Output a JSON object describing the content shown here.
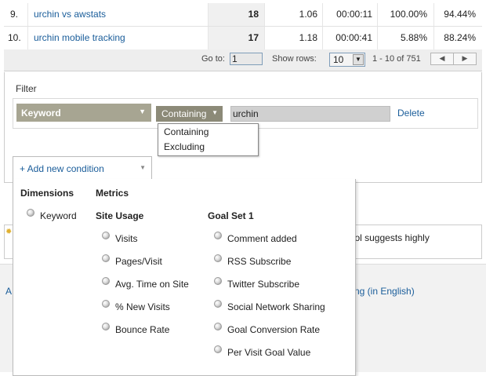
{
  "table": {
    "rows": [
      {
        "num": "9.",
        "keyword": "urchin vs awstats",
        "visits": "18",
        "pages_per_visit": "1.06",
        "avg_time": "00:00:11",
        "new_visits": "100.00%",
        "bounce_rate": "94.44%"
      },
      {
        "num": "10.",
        "keyword": "urchin mobile tracking",
        "visits": "17",
        "pages_per_visit": "1.18",
        "avg_time": "00:00:41",
        "new_visits": "5.88%",
        "bounce_rate": "88.24%"
      }
    ]
  },
  "pagination": {
    "goto_label": "Go to:",
    "goto_value": "1",
    "show_rows_label": "Show rows:",
    "show_rows_value": "10",
    "range_text": "1 - 10 of 751",
    "prev_icon": "◀",
    "next_icon": "▶"
  },
  "filter": {
    "title": "Filter",
    "dimension": "Keyword",
    "operator": "Containing",
    "value": "urchin",
    "delete_label": "Delete",
    "operator_options": [
      "Containing",
      "Excluding"
    ],
    "add_condition_label": "+ Add new condition"
  },
  "popup": {
    "dimensions_header": "Dimensions",
    "metrics_header": "Metrics",
    "dimensions": [
      "Keyword"
    ],
    "site_usage_header": "Site Usage",
    "site_usage": [
      "Visits",
      "Pages/Visit",
      "Avg. Time on Site",
      "% New Visits",
      "Bounce Rate"
    ],
    "goal_set_header": "Goal Set 1",
    "goal_set": [
      "Comment added",
      "RSS Subscribe",
      "Twitter Subscribe",
      "Social Network Sharing",
      "Goal Conversion Rate",
      "Per Visit Goal Value"
    ]
  },
  "background": {
    "notice_text": "rd Tool suggests highly",
    "footer_left": "A",
    "footer_right": "ng (in English)"
  },
  "colors": {
    "link": "#1a5d9a",
    "dimension_select": "#a7a592",
    "operator_select": "#8c8a78"
  }
}
